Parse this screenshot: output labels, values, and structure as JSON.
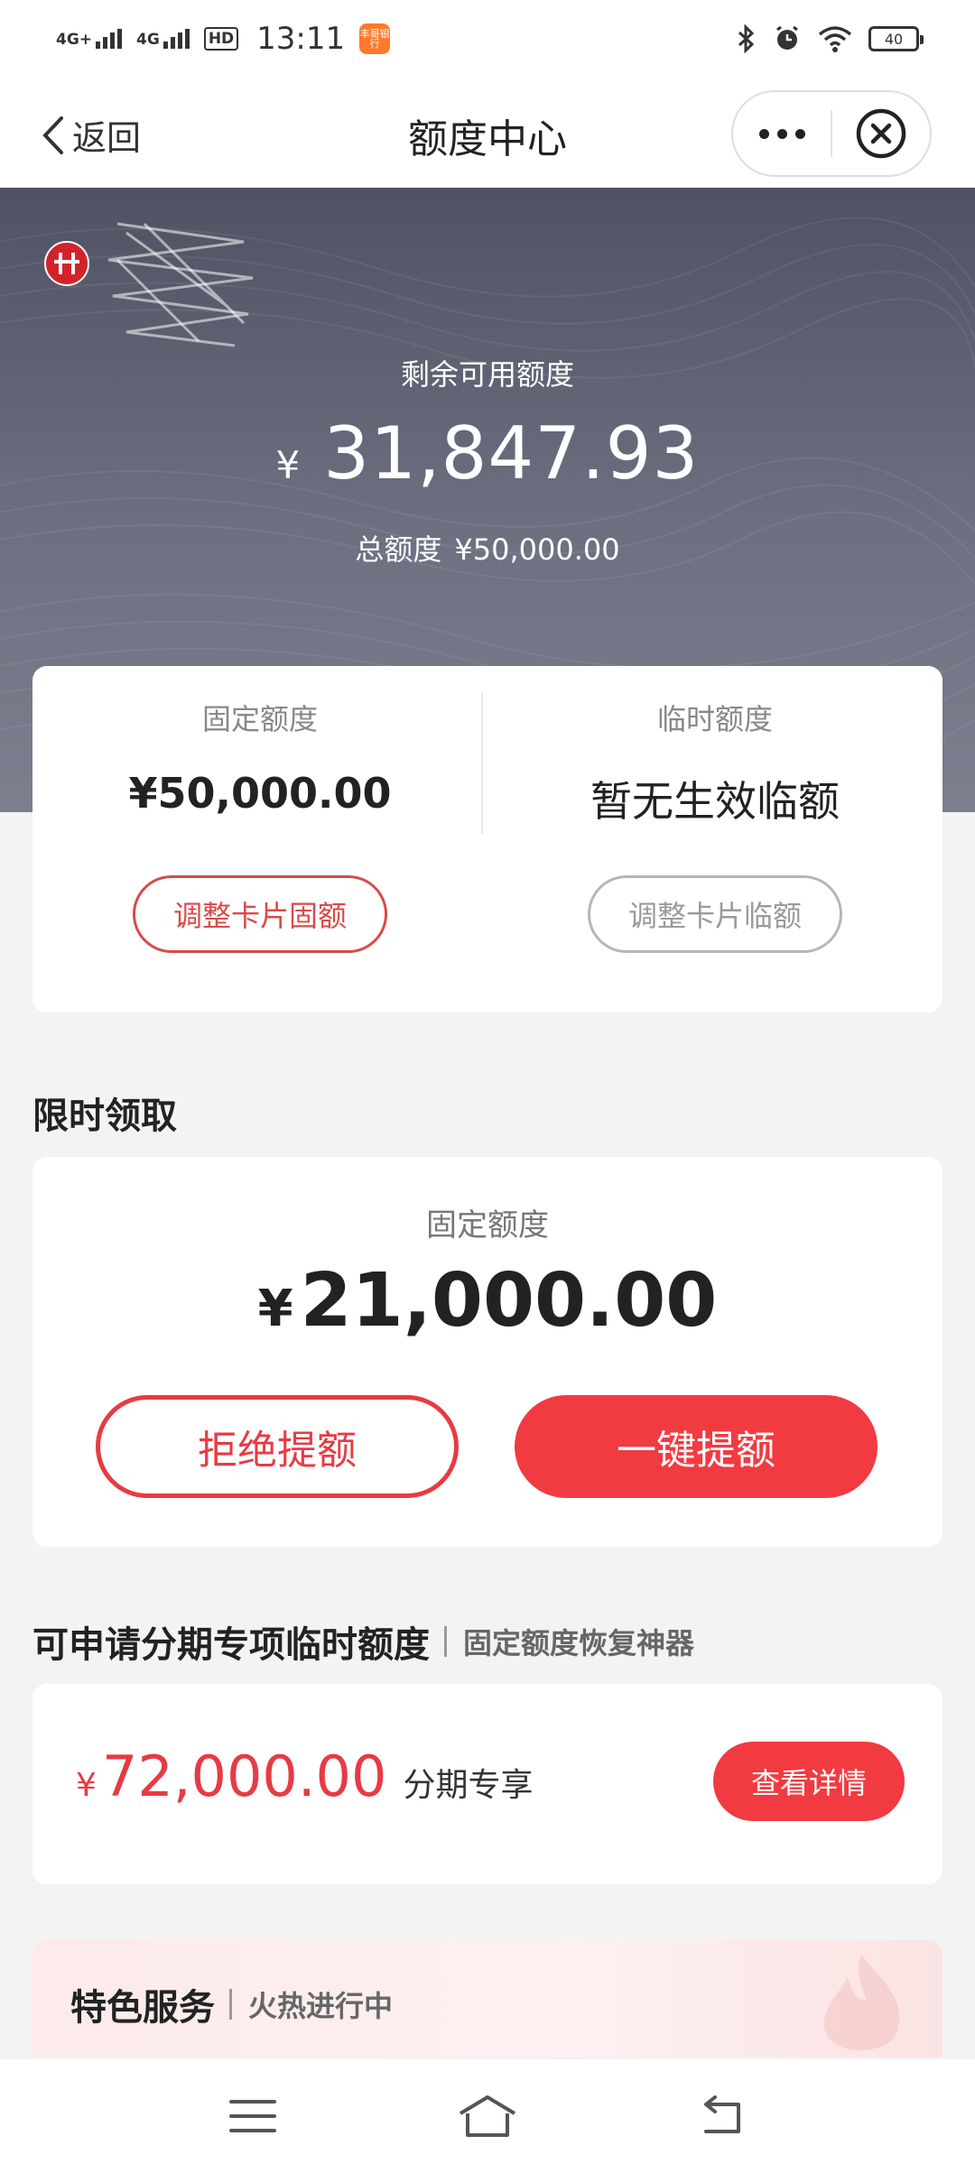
{
  "status_bar": {
    "network_1": "4G+",
    "network_2": "4G",
    "hd_badge": "HD",
    "time": "13:11",
    "notification_app": "丰哥银行",
    "battery": "40"
  },
  "nav": {
    "back_label": "返回",
    "title": "额度中心"
  },
  "hero": {
    "available_label": "剩余可用额度",
    "currency": "¥",
    "available_amount": "31,847.93",
    "total_label": "总额度",
    "total_amount": "¥50,000.00"
  },
  "limits": {
    "fixed_label": "固定额度",
    "fixed_value": "¥50,000.00",
    "fixed_button": "调整卡片固额",
    "temp_label": "临时额度",
    "temp_value": "暂无生效临额",
    "temp_button": "调整卡片临额"
  },
  "limited_offer": {
    "heading": "限时领取",
    "label": "固定额度",
    "currency": "¥",
    "amount": "21,000.00",
    "reject_button": "拒绝提额",
    "accept_button": "一键提额"
  },
  "installment": {
    "heading": "可申请分期专项临时额度",
    "subheading": "固定额度恢复神器",
    "currency": "¥",
    "amount": "72,000.00",
    "tag": "分期专享",
    "detail_button": "查看详情"
  },
  "featured": {
    "heading": "特色服务",
    "subheading": "火热进行中"
  },
  "colors": {
    "accent_red": "#f23a41",
    "hero_bg": "#5a5e6e",
    "page_bg": "#f3f3f3"
  },
  "icons": {
    "back": "chevron-left-icon",
    "more": "more-dots-icon",
    "close": "close-circle-icon",
    "bluetooth": "bluetooth-icon",
    "alarm": "alarm-icon",
    "wifi": "wifi-icon",
    "menu": "menu-icon",
    "home": "home-icon",
    "return": "return-icon"
  }
}
